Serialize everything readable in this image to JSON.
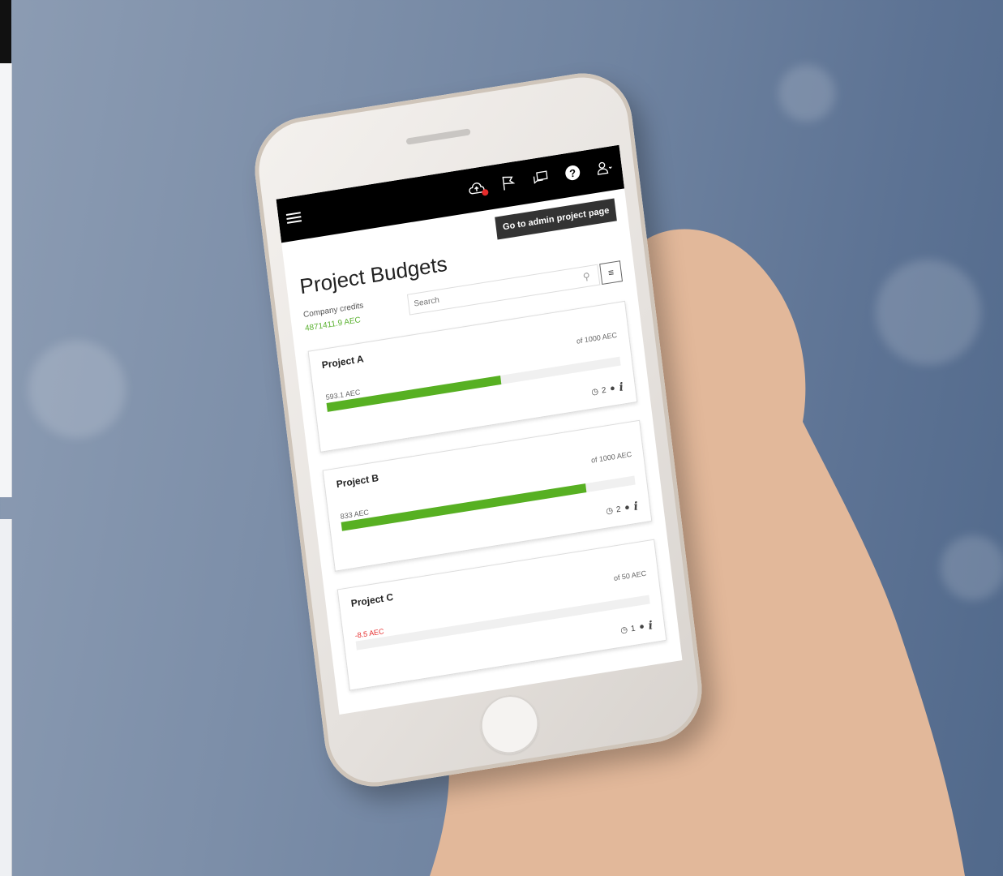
{
  "header": {
    "menu_icon": "hamburger-icon",
    "icons": [
      "cloud-upload-icon",
      "flag-icon",
      "chat-icon",
      "help-icon",
      "user-icon"
    ]
  },
  "page": {
    "admin_button": "Go to admin project page",
    "title": "Project Budgets",
    "credits_label": "Company credits",
    "credits_value": "4871411.9 AEC",
    "search_placeholder": "Search"
  },
  "projects": [
    {
      "name": "Project A",
      "total": "of 1000 AEC",
      "spent": "593.1 AEC",
      "progress_fraction": 0.593,
      "count": "2"
    },
    {
      "name": "Project B",
      "total": "of 1000 AEC",
      "spent": "833 AEC",
      "progress_fraction": 0.833,
      "count": "2"
    },
    {
      "name": "Project C",
      "total": "of 50 AEC",
      "spent": "-8.5 AEC",
      "progress_fraction": 0,
      "count": "1"
    }
  ],
  "colors": {
    "accent_green": "#57b022",
    "negative_red": "#e52b2b",
    "topbar": "#000000"
  }
}
